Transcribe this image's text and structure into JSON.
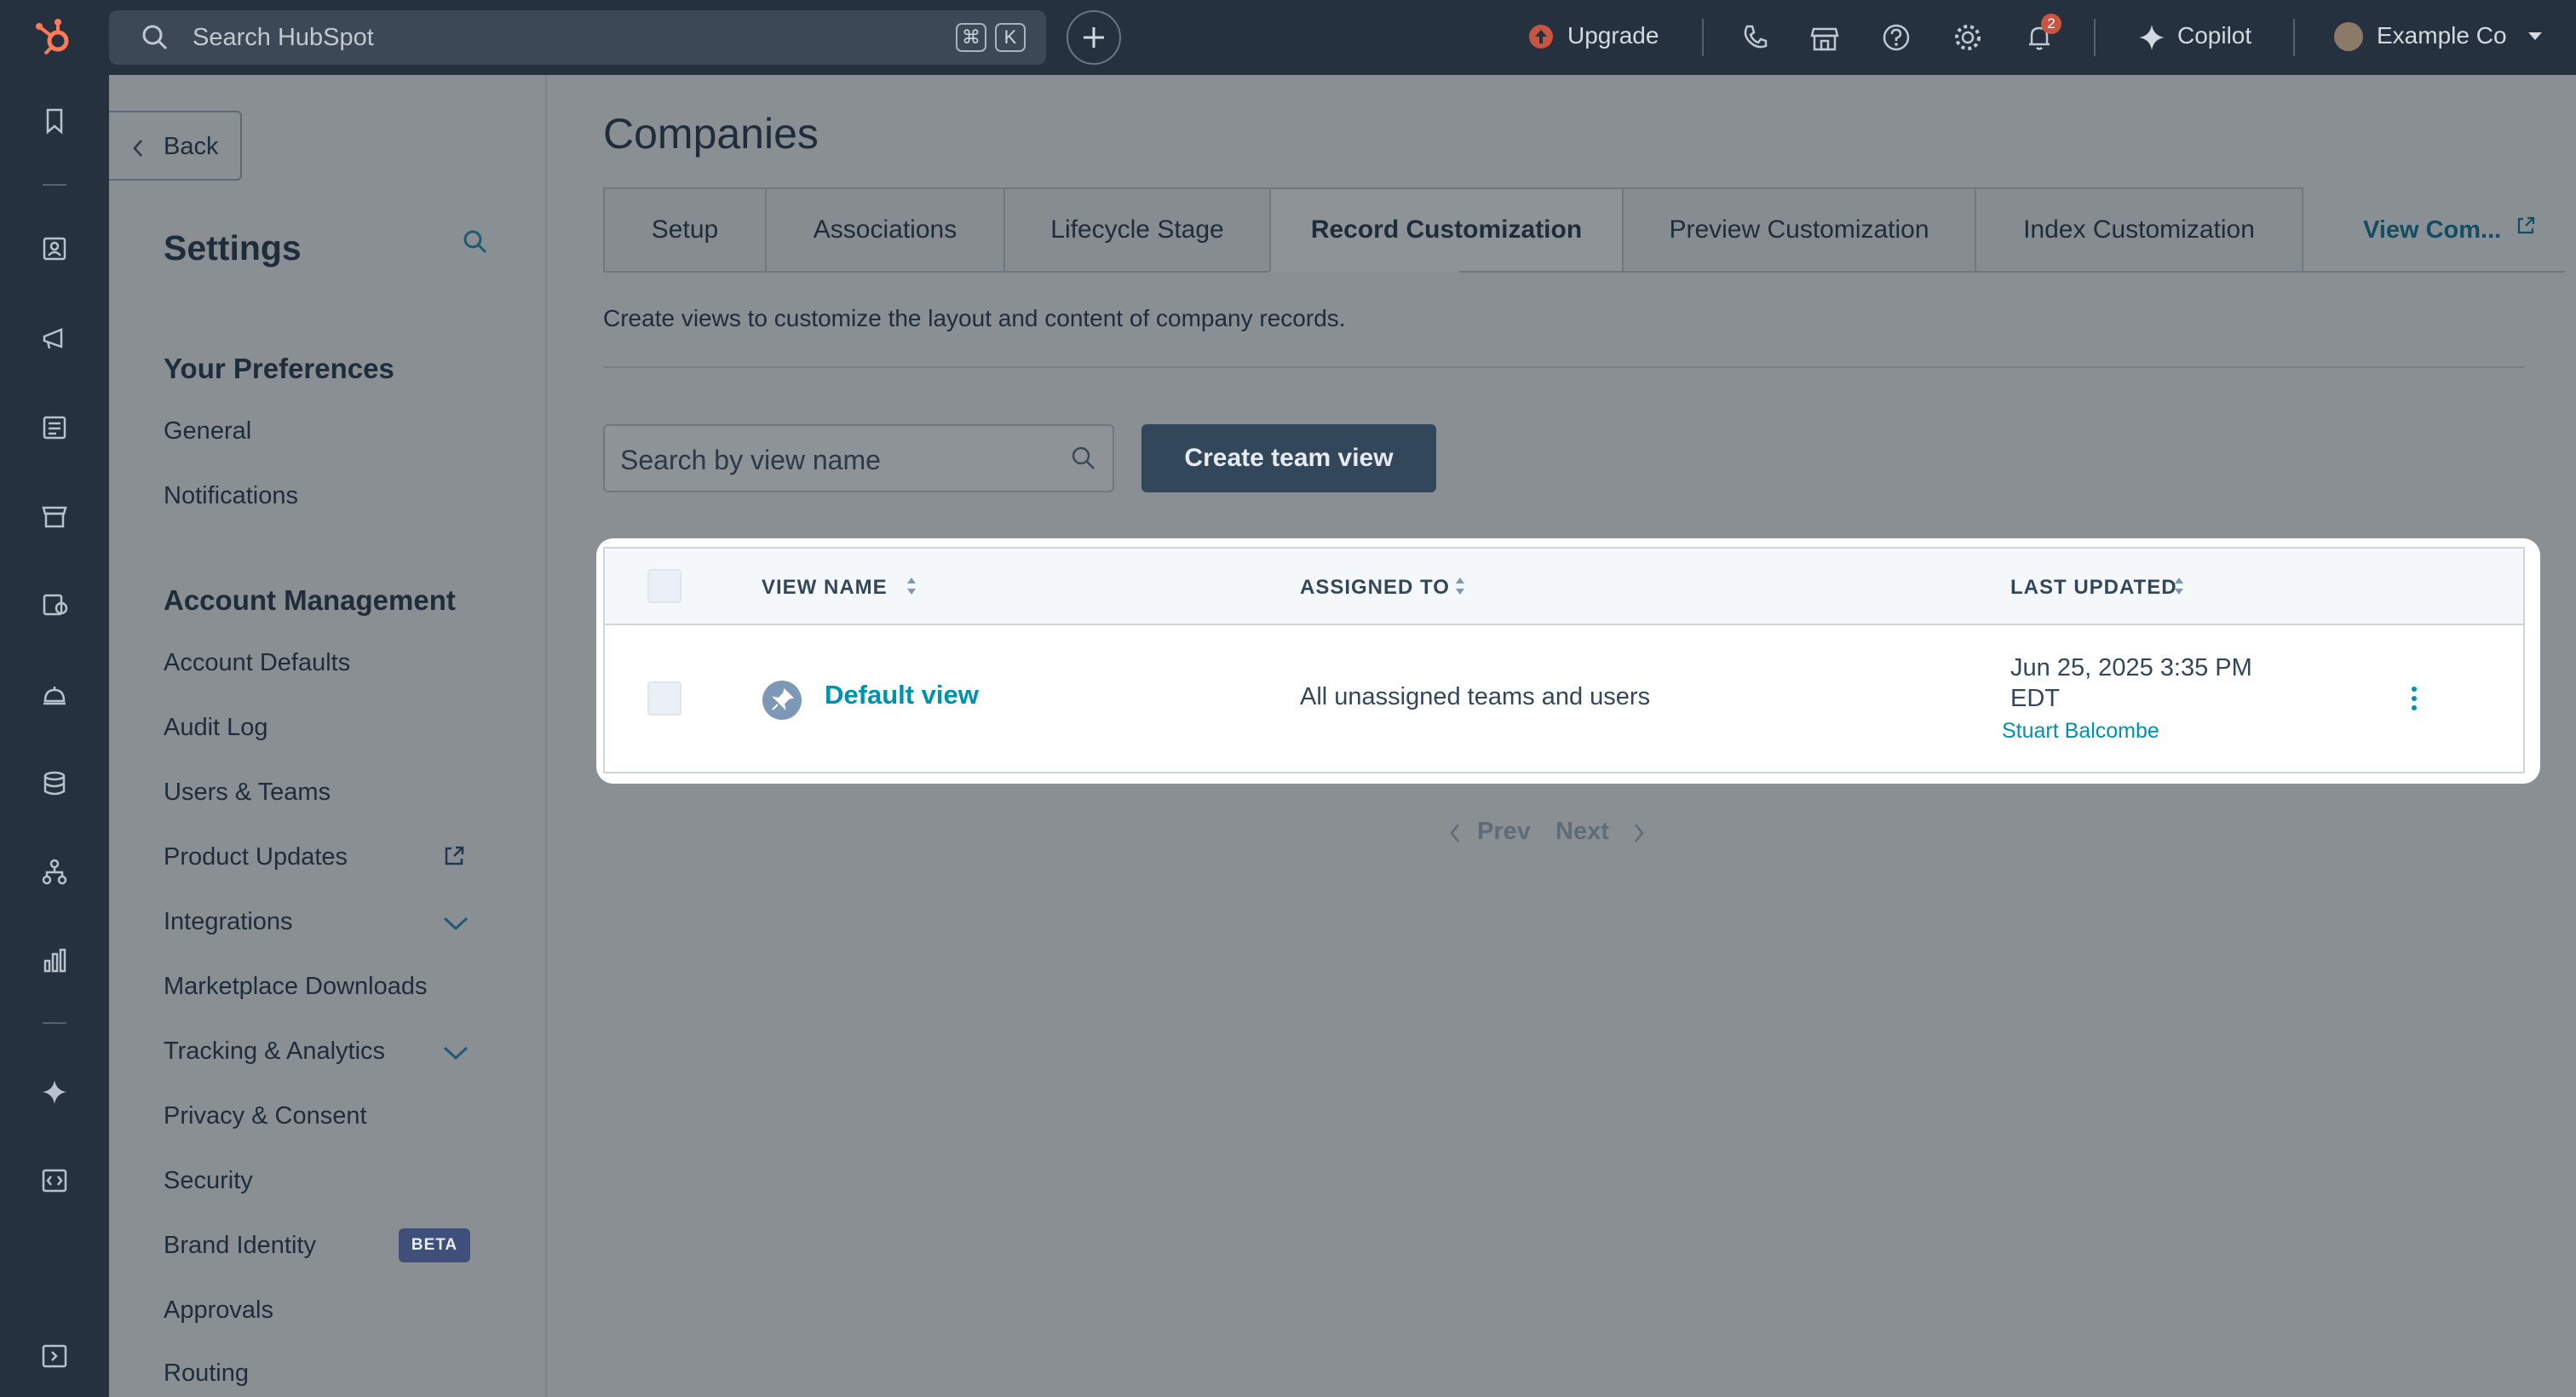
{
  "topbar": {
    "search_placeholder": "Search HubSpot",
    "shortcut_cmd": "⌘",
    "shortcut_key": "K",
    "upgrade_label": "Upgrade",
    "notification_count": "2",
    "copilot_label": "Copilot",
    "account_label": "Example Co"
  },
  "settings": {
    "back_label": "Back",
    "title": "Settings",
    "sections": [
      {
        "title": "Your Preferences",
        "items": [
          "General",
          "Notifications"
        ]
      },
      {
        "title": "Account Management",
        "items": [
          "Account Defaults",
          "Audit Log",
          "Users & Teams",
          "Product Updates",
          "Integrations",
          "Marketplace Downloads",
          "Tracking & Analytics",
          "Privacy & Consent",
          "Security",
          "Brand Identity",
          "Approvals",
          "Routing"
        ]
      }
    ],
    "beta_badge": "BETA"
  },
  "main": {
    "title": "Companies",
    "tabs": [
      "Setup",
      "Associations",
      "Lifecycle Stage",
      "Record Customization",
      "Preview Customization",
      "Index Customization"
    ],
    "active_tab": "Record Customization",
    "external_link": "View Com...",
    "description": "Create views to customize the layout and content of company records.",
    "search_placeholder": "Search by view name",
    "create_button": "Create team view",
    "table": {
      "headers": [
        "VIEW NAME",
        "ASSIGNED TO",
        "LAST UPDATED"
      ],
      "rows": [
        {
          "name": "Default view",
          "assigned_to": "All unassigned teams and users",
          "updated_date": "Jun 25, 2025 3:35 PM",
          "updated_tz": "EDT",
          "updated_by": "Stuart Balcombe"
        }
      ]
    },
    "pagination": {
      "prev": "Prev",
      "next": "Next"
    }
  },
  "colors": {
    "accent_link": "#0091ae",
    "dark_navy": "#25313f",
    "button_dark": "#33475b",
    "beta_badge": "#3d4f7a",
    "upgrade_icon": "#c9543f"
  }
}
